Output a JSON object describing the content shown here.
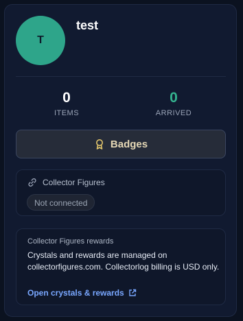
{
  "profile": {
    "avatar_initial": "T",
    "name": "test",
    "avatar_color": "#2ea58a"
  },
  "stats": {
    "items": {
      "value": "0",
      "label": "ITEMS"
    },
    "arrived": {
      "value": "0",
      "label": "ARRIVED",
      "color": "#34b38f"
    }
  },
  "badges_button": {
    "label": "Badges",
    "icon": "badge-award-icon"
  },
  "collector": {
    "title": "Collector Figures",
    "icon": "link-icon",
    "status": "Not connected"
  },
  "rewards": {
    "title": "Collector Figures rewards",
    "description": "Crystals and rewards are managed on collectorfigures.com. Collectorlog billing is USD only.",
    "link_label": "Open crystals & rewards",
    "link_icon": "external-link-icon"
  }
}
